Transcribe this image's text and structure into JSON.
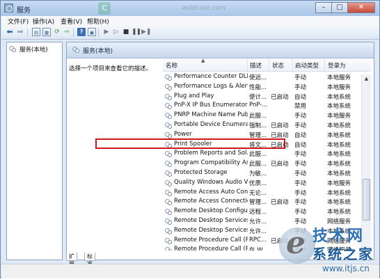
{
  "window": {
    "title": "服务",
    "close_symbol": "✕",
    "minimize_symbol": "–",
    "maximize_symbol": "□"
  },
  "background_watermark": {
    "logo_letter": "C",
    "url": "weblcate.com"
  },
  "menu": [
    "文件(F)",
    "操作(A)",
    "查看(V)",
    "帮助(H)"
  ],
  "tree": {
    "root_label": "服务(本地)"
  },
  "pane": {
    "title": "服务(本地)",
    "hint": "选择一个项目来查看它的描述。"
  },
  "columns": {
    "name": "名称",
    "desc": "描述",
    "status": "状态",
    "startup": "启动类型",
    "logon": "登录为"
  },
  "services": [
    {
      "name": "Performance Counter DLL...",
      "desc": "使远...",
      "status": "",
      "startup": "手动",
      "logon": "本地服务"
    },
    {
      "name": "Performance Logs & Alerts",
      "desc": "性能...",
      "status": "",
      "startup": "手动",
      "logon": "本地服务"
    },
    {
      "name": "Plug and Play",
      "desc": "使计...",
      "status": "已启动",
      "startup": "自动",
      "logon": "本地系统"
    },
    {
      "name": "PnP-X IP Bus Enumerator",
      "desc": "PnP-...",
      "status": "",
      "startup": "禁用",
      "logon": "本地系统"
    },
    {
      "name": "PNRP Machine Name Pub...",
      "desc": "此服...",
      "status": "",
      "startup": "手动",
      "logon": "本地服务"
    },
    {
      "name": "Portable Device Enumerat...",
      "desc": "强制...",
      "status": "已启动",
      "startup": "手动",
      "logon": "本地系统"
    },
    {
      "name": "Power",
      "desc": "管理...",
      "status": "已启动",
      "startup": "自动",
      "logon": "本地系统"
    },
    {
      "name": "Print Spooler",
      "desc": "将文...",
      "status": "已启动",
      "startup": "自动",
      "logon": "本地系统"
    },
    {
      "name": "Problem Reports and Sol...",
      "desc": "此服...",
      "status": "",
      "startup": "手动",
      "logon": "本地系统"
    },
    {
      "name": "Program Compatibility As...",
      "desc": "此服...",
      "status": "已启动",
      "startup": "手动",
      "logon": "本地系统"
    },
    {
      "name": "Protected Storage",
      "desc": "为敏...",
      "status": "",
      "startup": "手动",
      "logon": "本地系统"
    },
    {
      "name": "Quality Windows Audio Vi...",
      "desc": "优质...",
      "status": "",
      "startup": "手动",
      "logon": "本地服务"
    },
    {
      "name": "Remote Access Auto Con...",
      "desc": "无论...",
      "status": "",
      "startup": "手动",
      "logon": "本地系统"
    },
    {
      "name": "Remote Access Connectio...",
      "desc": "管理...",
      "status": "已启动",
      "startup": "手动",
      "logon": "本地系统"
    },
    {
      "name": "Remote Desktop Configu...",
      "desc": "远程...",
      "status": "",
      "startup": "手动",
      "logon": "本地系统"
    },
    {
      "name": "Remote Desktop Services",
      "desc": "允许...",
      "status": "",
      "startup": "手动",
      "logon": "网络服务"
    },
    {
      "name": "Remote Desktop Services...",
      "desc": "允许...",
      "status": "",
      "startup": "手动",
      "logon": "本地系统"
    },
    {
      "name": "Remote Procedure Call (R...",
      "desc": "RPC...",
      "status": "已启动",
      "startup": "自动",
      "logon": "网络服务"
    },
    {
      "name": "Remote Procedure Call (R...",
      "desc": "在 W...",
      "status": "",
      "startup": "手动",
      "logon": "网络服务"
    }
  ],
  "tabs": [
    "扩展",
    "标准"
  ],
  "watermark": {
    "line1": "技术网",
    "line2": "系统之家",
    "url": "www.itjs.cn"
  },
  "colors": {
    "highlight_border": "#d01818",
    "titlebar": "#a9c5e8",
    "close": "#c64a36"
  }
}
